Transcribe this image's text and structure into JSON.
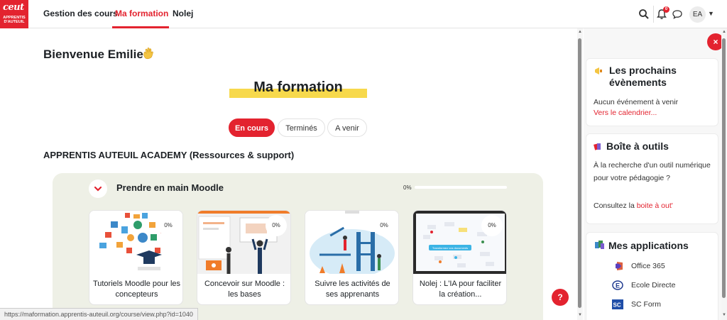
{
  "brand": {
    "logo_top": "ceut",
    "logo_bottom": "APPRENTIS D'AUTEUIL",
    "accent": "#e3232f"
  },
  "nav": {
    "links": [
      "Gestion des cours",
      "Ma formation",
      "Nolej"
    ],
    "active": "Ma formation",
    "notif_count": "0",
    "user_initials": "EA"
  },
  "main": {
    "welcome": "Bienvenue Emilie",
    "title": "Ma formation",
    "tabs": [
      "En cours",
      "Terminés",
      "A venir"
    ],
    "section_title": "APPRENTIS AUTEUIL ACADEMY (Ressources & support)",
    "course": {
      "name": "Prendre en main Moodle",
      "progress_label": "0%",
      "progress": 0
    },
    "cards": [
      {
        "title": "Tutoriels Moodle pour les concepteurs",
        "pct": "0%"
      },
      {
        "title": "Concevoir sur Moodle : les bases",
        "pct": "0%"
      },
      {
        "title": "Suivre les activités de ses apprenants",
        "pct": "0%"
      },
      {
        "title": "Nolej : L'IA pour faciliter la création...",
        "pct": "0%",
        "image_text": "Transformez vos documents"
      }
    ]
  },
  "status_url": "https://maformation.apprentis-auteuil.org/course/view.php?id=1040",
  "help_label": "?",
  "drawer": {
    "close_label": "×",
    "events": {
      "title": "Les prochains évènements",
      "empty": "Aucun événement à venir",
      "link": "Vers le calendrier..."
    },
    "toolbox": {
      "title": "Boîte à outils",
      "text": "À la recherche d'un outil numérique pour votre pédagogie ?",
      "consult": "Consultez la",
      "link": "boite à out'"
    },
    "apps": {
      "title": "Mes applications",
      "items": [
        "Office 365",
        "Ecole Directe",
        "SC Form"
      ]
    }
  }
}
